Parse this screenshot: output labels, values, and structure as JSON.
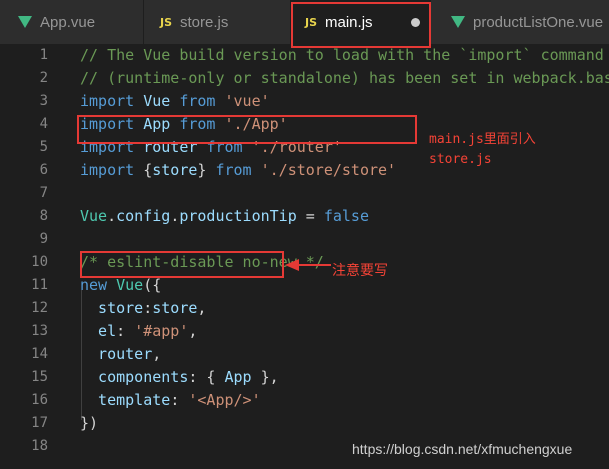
{
  "tabs": [
    {
      "label": "App.vue",
      "icon": "vue-icon",
      "active": false
    },
    {
      "label": "store.js",
      "icon": "js-icon",
      "active": false
    },
    {
      "label": "main.js",
      "icon": "js-icon",
      "active": true,
      "modified": true
    },
    {
      "label": "productListOne.vue",
      "icon": "vue-icon",
      "active": false
    }
  ],
  "js_icon_text": "JS",
  "lines": [
    {
      "n": "1",
      "tokens": [
        {
          "t": "// The Vue build version to load with the `import` command",
          "c": "cm"
        }
      ]
    },
    {
      "n": "2",
      "tokens": [
        {
          "t": "// (runtime-only or standalone) has been set in webpack.base",
          "c": "cm"
        }
      ]
    },
    {
      "n": "3",
      "tokens": [
        {
          "t": "import ",
          "c": "kw"
        },
        {
          "t": "Vue ",
          "c": "id"
        },
        {
          "t": "from ",
          "c": "kw"
        },
        {
          "t": "'vue'",
          "c": "str"
        }
      ]
    },
    {
      "n": "4",
      "tokens": [
        {
          "t": "import ",
          "c": "kw"
        },
        {
          "t": "App ",
          "c": "id"
        },
        {
          "t": "from ",
          "c": "kw"
        },
        {
          "t": "'./App'",
          "c": "str"
        }
      ]
    },
    {
      "n": "5",
      "tokens": [
        {
          "t": "import ",
          "c": "kw"
        },
        {
          "t": "router ",
          "c": "id"
        },
        {
          "t": "from ",
          "c": "kw"
        },
        {
          "t": "'./router'",
          "c": "str"
        }
      ]
    },
    {
      "n": "6",
      "tokens": [
        {
          "t": "import ",
          "c": "kw"
        },
        {
          "t": "{",
          "c": "p"
        },
        {
          "t": "store",
          "c": "id"
        },
        {
          "t": "} ",
          "c": "p"
        },
        {
          "t": "from ",
          "c": "kw"
        },
        {
          "t": "'./store/store'",
          "c": "str"
        }
      ]
    },
    {
      "n": "7",
      "tokens": []
    },
    {
      "n": "8",
      "tokens": [
        {
          "t": "Vue",
          "c": "cls"
        },
        {
          "t": ".",
          "c": "p"
        },
        {
          "t": "config",
          "c": "id"
        },
        {
          "t": ".",
          "c": "p"
        },
        {
          "t": "productionTip",
          "c": "id"
        },
        {
          "t": " = ",
          "c": "p"
        },
        {
          "t": "false",
          "c": "lit"
        }
      ]
    },
    {
      "n": "9",
      "tokens": []
    },
    {
      "n": "10",
      "tokens": [
        {
          "t": "/* eslint-disable no-new */",
          "c": "cm"
        }
      ]
    },
    {
      "n": "11",
      "tokens": [
        {
          "t": "new ",
          "c": "kw"
        },
        {
          "t": "Vue",
          "c": "cls"
        },
        {
          "t": "({",
          "c": "p"
        }
      ]
    },
    {
      "n": "12",
      "tokens": [
        {
          "t": "  store",
          "c": "id"
        },
        {
          "t": ":",
          "c": "p"
        },
        {
          "t": "store",
          "c": "id"
        },
        {
          "t": ",",
          "c": "p"
        }
      ]
    },
    {
      "n": "13",
      "tokens": [
        {
          "t": "  el",
          "c": "id"
        },
        {
          "t": ": ",
          "c": "p"
        },
        {
          "t": "'#app'",
          "c": "str"
        },
        {
          "t": ",",
          "c": "p"
        }
      ]
    },
    {
      "n": "14",
      "tokens": [
        {
          "t": "  router",
          "c": "id"
        },
        {
          "t": ",",
          "c": "p"
        }
      ]
    },
    {
      "n": "15",
      "tokens": [
        {
          "t": "  components",
          "c": "id"
        },
        {
          "t": ": { ",
          "c": "p"
        },
        {
          "t": "App",
          "c": "id"
        },
        {
          "t": " },",
          "c": "p"
        }
      ]
    },
    {
      "n": "16",
      "tokens": [
        {
          "t": "  template",
          "c": "id"
        },
        {
          "t": ": ",
          "c": "p"
        },
        {
          "t": "'<App/>'",
          "c": "str"
        }
      ]
    },
    {
      "n": "17",
      "tokens": [
        {
          "t": "})",
          "c": "p"
        }
      ]
    },
    {
      "n": "18",
      "tokens": []
    }
  ],
  "annotations": {
    "import_note_line1": "main.js里面引入",
    "import_note_line2": "store.js",
    "store_note": "注意要写"
  },
  "watermark": "https://blog.csdn.net/xfmuchengxue",
  "colors": {
    "highlight": "#e53935",
    "annotation": "#f44336"
  }
}
